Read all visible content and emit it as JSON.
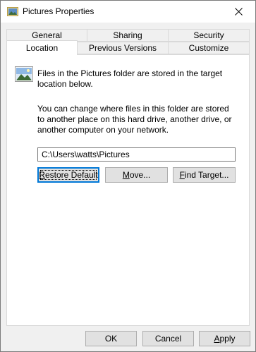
{
  "window": {
    "title": "Pictures Properties",
    "icons": {
      "title": "pictures-folder-icon",
      "close": "close-icon",
      "location": "pictures-folder-icon"
    }
  },
  "tabs": {
    "top_row": [
      "General",
      "Sharing",
      "Security"
    ],
    "bottom_row": [
      "Location",
      "Previous Versions",
      "Customize"
    ],
    "active": "Location"
  },
  "location": {
    "description": "Files in the Pictures folder are stored in the target location below.",
    "info": "You can change where files in this folder are stored to another place on this hard drive, another drive, or another computer on your network.",
    "path": "C:\\Users\\watts\\Pictures"
  },
  "buttons": {
    "restore_default": {
      "first": "R",
      "rest": "estore Default"
    },
    "move": {
      "first": "M",
      "rest": "ove..."
    },
    "find_target": {
      "first": "F",
      "rest": "ind Target..."
    }
  },
  "footer": {
    "ok": "OK",
    "cancel": "Cancel",
    "apply": {
      "first": "A",
      "rest": "pply"
    }
  }
}
